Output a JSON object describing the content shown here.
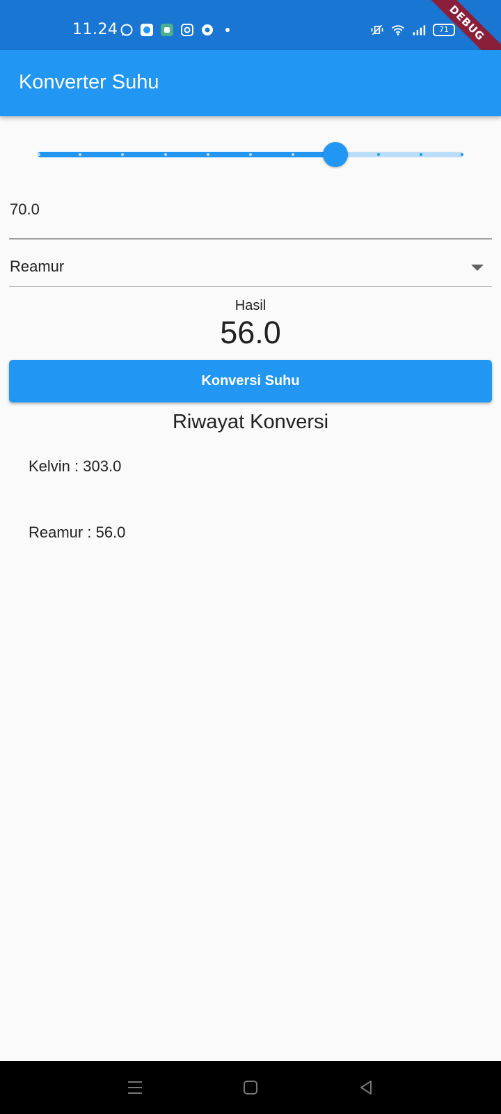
{
  "status_bar": {
    "time": "11.24",
    "left_icons": [
      "whatsapp-icon",
      "app-icon-blue",
      "app-icon-green",
      "instagram-icon",
      "app-icon-circle",
      "dot-icon"
    ],
    "right_icons": [
      "vibrate-icon",
      "wifi-icon",
      "signal-icon"
    ],
    "battery": "71"
  },
  "debug_banner": "DEBUG",
  "app_bar": {
    "title": "Konverter Suhu"
  },
  "slider": {
    "value_fraction": 0.7,
    "divisions": 10
  },
  "temperature_input": {
    "value": "70.0"
  },
  "unit_dropdown": {
    "selected": "Reamur"
  },
  "result": {
    "label": "Hasil",
    "value": "56.0"
  },
  "convert_button": {
    "label": "Konversi Suhu"
  },
  "history": {
    "title": "Riwayat Konversi",
    "items": [
      "Kelvin : 303.0",
      "Reamur : 56.0"
    ]
  },
  "colors": {
    "primary": "#2196f3",
    "primary_dark": "#1976d2",
    "track_inactive": "#bbdefb",
    "background": "#fafafa"
  }
}
